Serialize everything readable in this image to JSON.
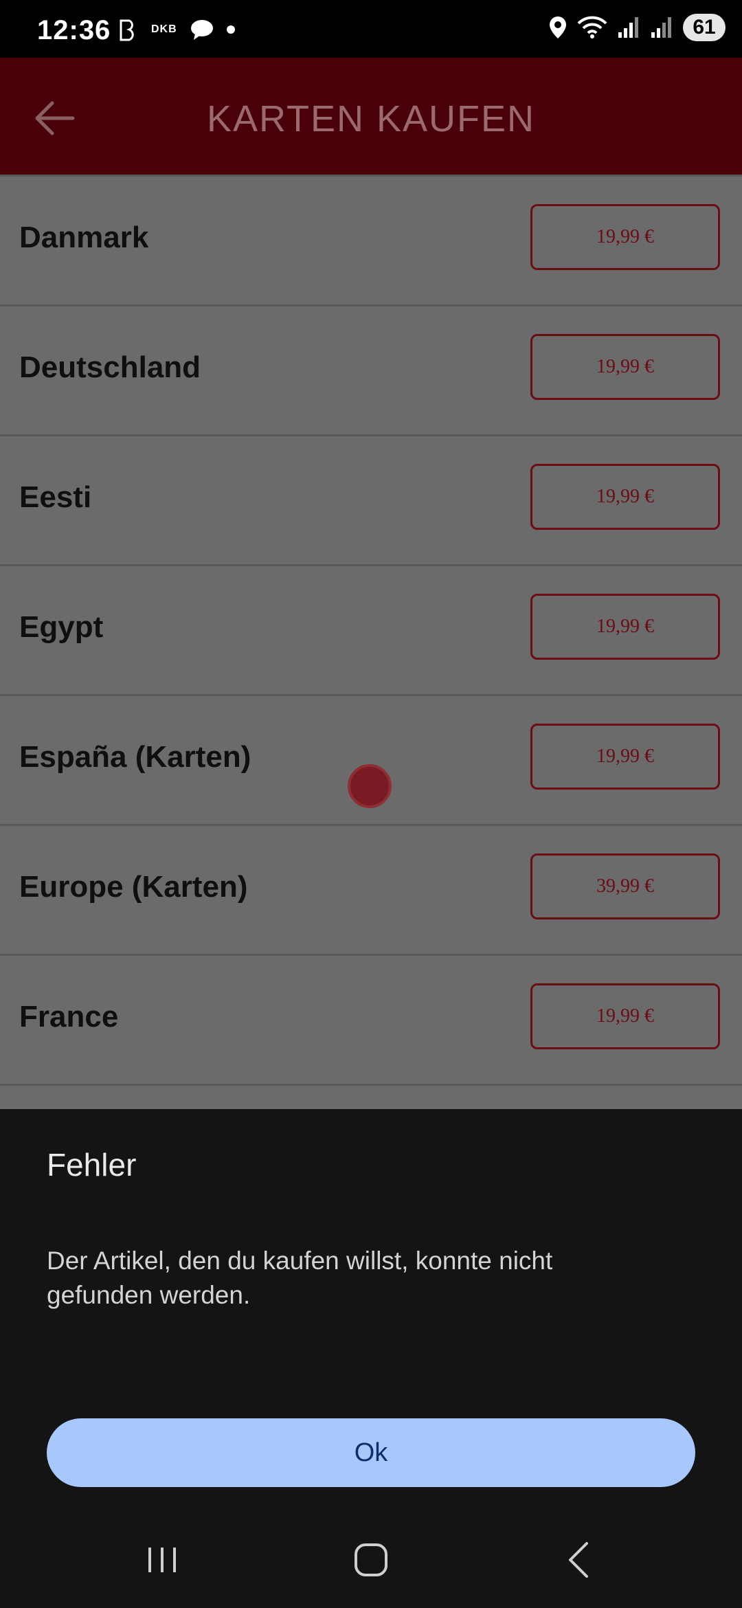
{
  "status_bar": {
    "time": "12:36",
    "carrier_label": "DKB",
    "battery_level": "61",
    "icons": [
      "b-icon",
      "chat-icon",
      "location-icon",
      "wifi-icon",
      "signal-icon"
    ]
  },
  "app_bar": {
    "title": "KARTEN KAUFEN",
    "back_icon": "arrow-left-icon"
  },
  "list": {
    "items": [
      {
        "label": "Danmark",
        "price": "19,99 €"
      },
      {
        "label": "Deutschland",
        "price": "19,99 €"
      },
      {
        "label": "Eesti",
        "price": "19,99 €"
      },
      {
        "label": "Egypt",
        "price": "19,99 €"
      },
      {
        "label": "España (Karten)",
        "price": "19,99 €"
      },
      {
        "label": "Europe (Karten)",
        "price": "39,99 €"
      },
      {
        "label": "France",
        "price": "19,99 €"
      }
    ]
  },
  "dialog": {
    "title": "Fehler",
    "message": "Der Artikel, den du kaufen willst, konnte nicht gefunden werden.",
    "ok_label": "Ok"
  },
  "nav_bar": {
    "icons": [
      "recent-apps-icon",
      "home-icon",
      "back-icon"
    ]
  },
  "colors": {
    "app_bar": "#4a0008",
    "accent_price": "#6a0d14",
    "ok_button": "#a8c7fa",
    "sheet": "#141414"
  }
}
